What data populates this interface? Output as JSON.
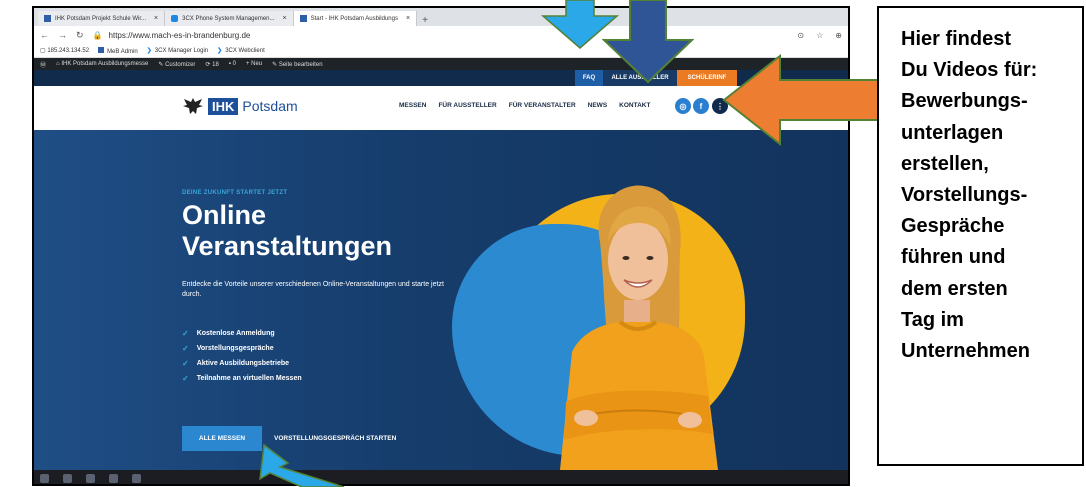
{
  "browser": {
    "tabs": [
      {
        "label": "IHK Potsdam Projekt Schule Wir..."
      },
      {
        "label": "3CX Phone System Managemen..."
      },
      {
        "label": "Start - IHK Potsdam Ausbildungs"
      }
    ],
    "url": "https://www.mach-es-in-brandenburg.de",
    "bookmarks": [
      "185.243.134.52",
      "MeB Admin",
      "3CX Manager Login",
      "3CX Webclient"
    ],
    "admin_bar": [
      "IHK Potsdam Ausbildungsmesse",
      "Customizer",
      "18",
      "0",
      "+ Neu",
      "Seite bearbeiten"
    ]
  },
  "site": {
    "top_links": [
      "FAQ",
      "ALLE AUSSTELLER",
      "SCHÜLERINF"
    ],
    "logo": {
      "ihk": "IHK",
      "name": "Potsdam"
    },
    "nav": [
      "MESSEN",
      "FÜR AUSSTELLER",
      "FÜR VERANSTALTER",
      "NEWS",
      "KONTAKT"
    ],
    "hero": {
      "kicker": "DEINE ZUKUNFT STARTET JETZT",
      "title": "Online Veranstaltungen",
      "lead": "Entdecke die Vorteile unserer verschiedenen Online-Veranstaltungen und starte jetzt durch.",
      "features": [
        "Kostenlose Anmeldung",
        "Vorstellungsgespräche",
        "Aktive Ausbildungsbetriebe",
        "Teilnahme an virtuellen Messen"
      ],
      "primary_button": "ALLE MESSEN",
      "secondary_button": "VORSTELLUNGSGESPRÄCH STARTEN"
    }
  },
  "annotation": {
    "text": "Hier findest\nDu Videos für:\nBewerbungs-\nunterlagen\nerstellen,\nVorstellungs-\nGespräche\nführen und\ndem ersten\nTag im\nUnternehmen"
  },
  "colors": {
    "arrow_light_blue": "#2aa8e8",
    "arrow_dark_blue": "#2f5597",
    "arrow_orange": "#ed7d31",
    "arrow_outline": "#548235"
  }
}
